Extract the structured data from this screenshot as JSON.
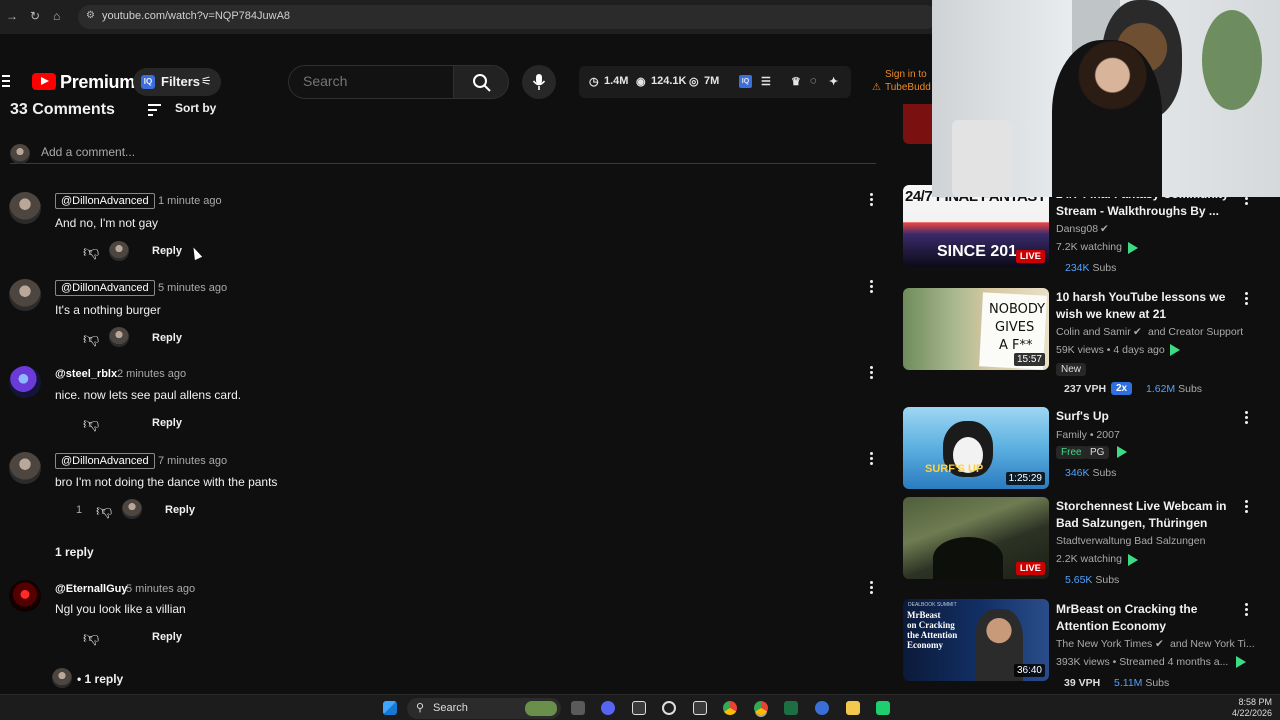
{
  "browser": {
    "url": "youtube.com/watch?v=NQP784JuwA8"
  },
  "header": {
    "brand": "Premium",
    "filters_label": "Filters",
    "tubebuddy_badge": "IQ",
    "search_placeholder": "Search",
    "stats": {
      "subs": "1.4M",
      "views": "124.1K",
      "total_views": "7M"
    },
    "sign_in": {
      "line1": "Sign in to",
      "line2": "TubeBudd"
    }
  },
  "comments": {
    "title": "33 Comments",
    "sort_label": "Sort by",
    "add_placeholder": "Add a comment...",
    "reply_label": "Reply",
    "items": [
      {
        "handle": "@DillonAdvanced",
        "time": "1 minute ago",
        "text": "And no, I'm not gay",
        "likes": ""
      },
      {
        "handle": "@DillonAdvanced",
        "time": "5 minutes ago",
        "text": "It's a nothing burger",
        "likes": ""
      },
      {
        "handle": "@steel_rblx",
        "time": "2 minutes ago",
        "text": "nice. now lets see paul allens card.",
        "likes": ""
      },
      {
        "handle": "@DillonAdvanced",
        "time": "7 minutes ago",
        "text": "bro I'm not doing the dance with the pants",
        "likes": "1",
        "replies": "1 reply"
      },
      {
        "handle": "@EternallGuy",
        "time": "5 minutes ago",
        "text": "Ngl you look like a villian",
        "likes": "",
        "replies": "• 1 reply"
      }
    ]
  },
  "related": [
    {
      "title_line1": "24/7 Final Fantasy Community",
      "title_line2": "Stream - Walkthroughs By ...",
      "channel": "Dansg08",
      "meta": "7.2K watching",
      "badge": "LIVE",
      "subs": "234K",
      "subs_label": "Subs",
      "thumb_text1": "24/7 FINAL FANTASY",
      "thumb_text2": "SINCE 201"
    },
    {
      "title_line1": "10 harsh YouTube lessons we",
      "title_line2": "wish we knew at 21",
      "channel": "Colin and Samir",
      "channel_extra": "and Creator Support",
      "meta": "59K views • 4 days ago",
      "duration": "15:57",
      "tag_new": "New",
      "vph": "237 VPH",
      "mult": "2x",
      "subs": "1.62M",
      "subs_label": "Subs",
      "thumb_text1": "NOBODY",
      "thumb_text2": "GIVES",
      "thumb_text3": "A F**"
    },
    {
      "title_line1": "Surf's Up",
      "channel": "Family • 2007",
      "tag_free": "Free",
      "tag_pg": "PG",
      "duration": "1:25:29",
      "subs": "346K",
      "subs_label": "Subs",
      "thumb_text1": "SURF'S UP"
    },
    {
      "title_line1": "Storchennest Live Webcam in",
      "title_line2": "Bad Salzungen, Thüringen",
      "channel": "Stadtverwaltung Bad Salzungen",
      "meta": "2.2K watching",
      "badge": "LIVE",
      "subs": "5.65K",
      "subs_label": "Subs"
    },
    {
      "title_line1": "MrBeast on Cracking the",
      "title_line2": "Attention Economy",
      "channel": "The New York Times",
      "channel_extra": "and New York Ti...",
      "meta": "393K views • Streamed 4 months a...",
      "duration": "36:40",
      "vph": "39 VPH",
      "subs": "5.11M",
      "subs_label": "Subs",
      "thumb_text1": "MrBeast",
      "thumb_text2": "on Cracking",
      "thumb_text3": "the Attention",
      "thumb_text4": "Economy",
      "thumb_top": "DEALBOOK SUMMIT"
    }
  ],
  "taskbar": {
    "search_label": "Search",
    "time": "8:58 PM",
    "date": "4/22/2026"
  },
  "colors": {
    "accent_red": "#ff0000",
    "live_red": "#cc0000",
    "subs_blue": "#4fa3ff",
    "green": "#3ddc84",
    "tubebuddy_orange": "#f08a24"
  }
}
